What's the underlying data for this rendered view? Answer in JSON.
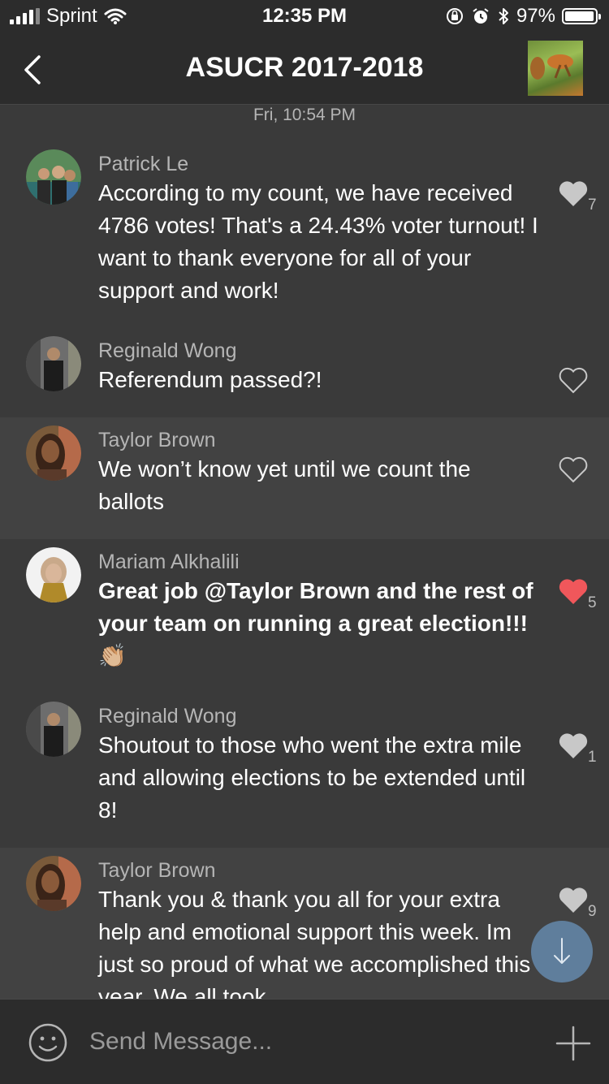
{
  "status": {
    "carrier": "Sprint",
    "time": "12:35 PM",
    "battery": "97%",
    "battery_level": 0.97
  },
  "header": {
    "title": "ASUCR 2017-2018"
  },
  "date_separator": "Fri, 10:54 PM",
  "messages": [
    {
      "sender": "Patrick Le",
      "text": "According to my count, we have received 4786 votes! That's a 24.43% voter turnout! I want to thank everyone for all of your support and work!",
      "likes": "7",
      "liked": false
    },
    {
      "sender": "Reginald Wong",
      "text": "Referendum passed?!",
      "likes": "",
      "liked": false
    },
    {
      "sender": "Taylor Brown",
      "text": "We won’t know yet until we count the ballots",
      "likes": "",
      "liked": false
    },
    {
      "sender": "Mariam Alkhalili",
      "text": "Great job @Taylor Brown and the rest of your team on running a great election!!! 👏🏼",
      "likes": "5",
      "liked": true
    },
    {
      "sender": "Reginald Wong",
      "text": "Shoutout to those who went the extra mile and allowing elections to be extended until 8!",
      "likes": "1",
      "liked": false
    },
    {
      "sender": "Taylor Brown",
      "text": "Thank you & thank you all for your extra help and emotional support this week. Im just so proud of what we accomplished this year. We all took",
      "likes": "9",
      "liked": false
    }
  ],
  "composer": {
    "placeholder": "Send Message..."
  },
  "colors": {
    "background": "#3a3a3a",
    "bar": "#2c2c2c",
    "alt_row": "#424242",
    "liked_heart": "#f0575b",
    "heart": "#c8c8c8",
    "fab": "#5f7e9c"
  }
}
